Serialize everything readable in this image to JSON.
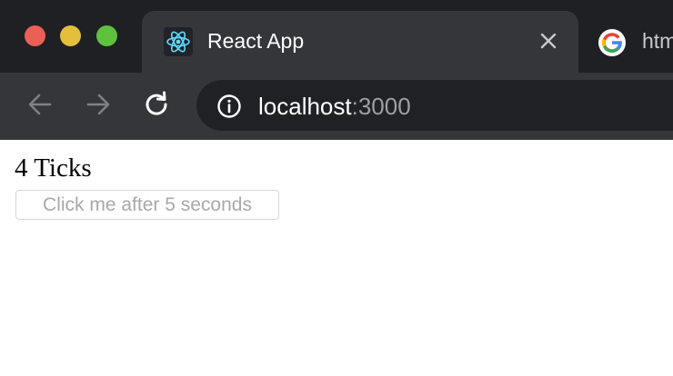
{
  "browser": {
    "tabs": [
      {
        "title": "React App",
        "favicon": "react-logo-icon",
        "active": true
      },
      {
        "title": "htm",
        "favicon": "google-g-icon",
        "active": false
      }
    ],
    "address_bar": {
      "host": "localhost",
      "port": ":3000"
    }
  },
  "page": {
    "heading": "4 Ticks",
    "button_label": "Click me after 5 seconds",
    "button_disabled": true
  },
  "colors": {
    "tabstrip_bg": "#1f2023",
    "toolbar_bg": "#35363a",
    "omnibox_bg": "#202124",
    "close_red": "#ec5f57",
    "minimize_yellow": "#e5bf3c",
    "zoom_green": "#5ec23f",
    "react_cyan": "#61dafb"
  }
}
